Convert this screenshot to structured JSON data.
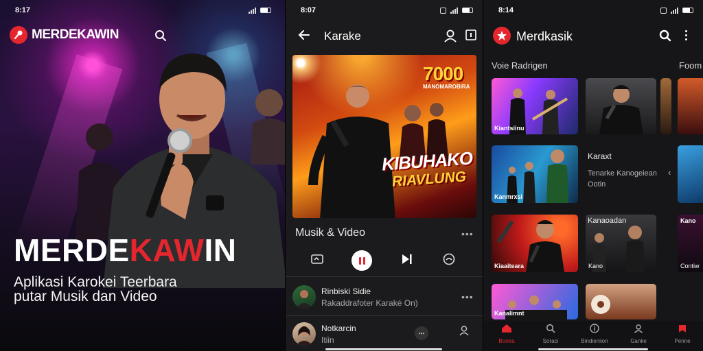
{
  "screen1": {
    "status_time": "8:17",
    "app_name": "MERDEKAWIN",
    "hero_title_part1": "MERDE",
    "hero_title_accent": "KAW",
    "hero_title_part2": "IN",
    "hero_sub_line1": "Aplikasi Karokei Teerbara",
    "hero_sub_line2": "putar Musik dan Video"
  },
  "screen2": {
    "status_time": "8:07",
    "title": "Karake",
    "poster_number": "7000",
    "poster_small": "MANOMAROBIRA",
    "poster_big1": "KIBUHAKO",
    "poster_big2": "RIAVLUNG",
    "section_label": "Musik & Video",
    "tracks": [
      {
        "title": "Rinbiski Sidie",
        "subtitle": "Rakaddrafoter Karaké On)"
      },
      {
        "title": "Notkarcin",
        "subtitle": "Itiin"
      }
    ]
  },
  "screen3": {
    "status_time": "8:14",
    "title": "Merdkasik",
    "section_left": "Voie Radrigen",
    "section_right": "Foom",
    "cards": [
      {
        "title": "Karaxt",
        "subtitle": "Tenarke Kanogeiean Ootin"
      },
      {
        "title": "Kanaoadan",
        "subtitle": "Kano"
      },
      {
        "title": "Kano",
        "subtitle": "Contiw"
      }
    ],
    "thumb_caps": [
      "Kiantsiinu",
      "Kanmrxsi",
      "Kiaaiteara",
      "Kanalimnt"
    ],
    "nav": [
      {
        "label": "Bonea",
        "icon": "home-icon",
        "active": true
      },
      {
        "label": "Soraci",
        "icon": "search-icon",
        "active": false
      },
      {
        "label": "Bindieniion",
        "icon": "info-icon",
        "active": false
      },
      {
        "label": "Ganke",
        "icon": "person-icon",
        "active": false
      },
      {
        "label": "Penne",
        "icon": "bookmark-icon",
        "active": false
      }
    ]
  },
  "colors": {
    "accent": "#e5262f",
    "background": "#161618"
  }
}
